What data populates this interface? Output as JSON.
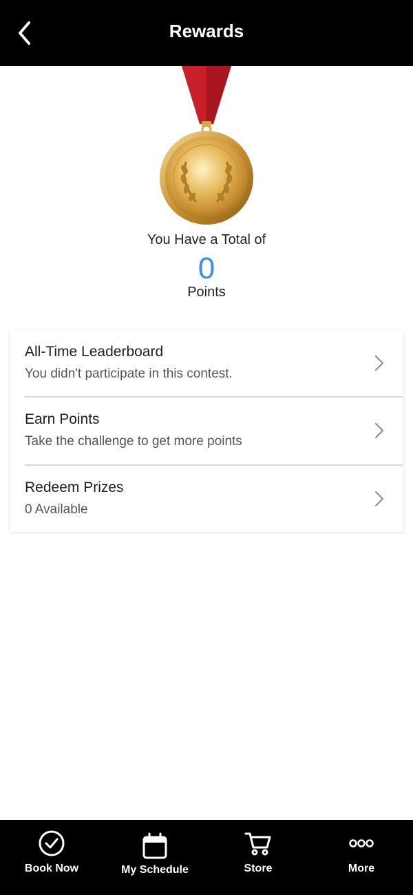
{
  "header": {
    "title": "Rewards",
    "back_icon": "chevron-left-icon"
  },
  "summary": {
    "total_label": "You Have a Total of",
    "points": "0",
    "points_label": "Points",
    "accent_color": "#3a8ee0",
    "medal_icon": "gold-medal-icon"
  },
  "menu": {
    "items": [
      {
        "title": "All-Time Leaderboard",
        "subtitle": "You didn't participate in this contest."
      },
      {
        "title": "Earn Points",
        "subtitle": "Take the challenge to get more points"
      },
      {
        "title": "Redeem Prizes",
        "subtitle": "0 Available"
      }
    ]
  },
  "tabbar": {
    "items": [
      {
        "label": "Book Now",
        "icon": "check-circle-icon"
      },
      {
        "label": "My Schedule",
        "icon": "calendar-icon"
      },
      {
        "label": "Store",
        "icon": "cart-icon"
      },
      {
        "label": "More",
        "icon": "more-dots-icon"
      }
    ]
  }
}
